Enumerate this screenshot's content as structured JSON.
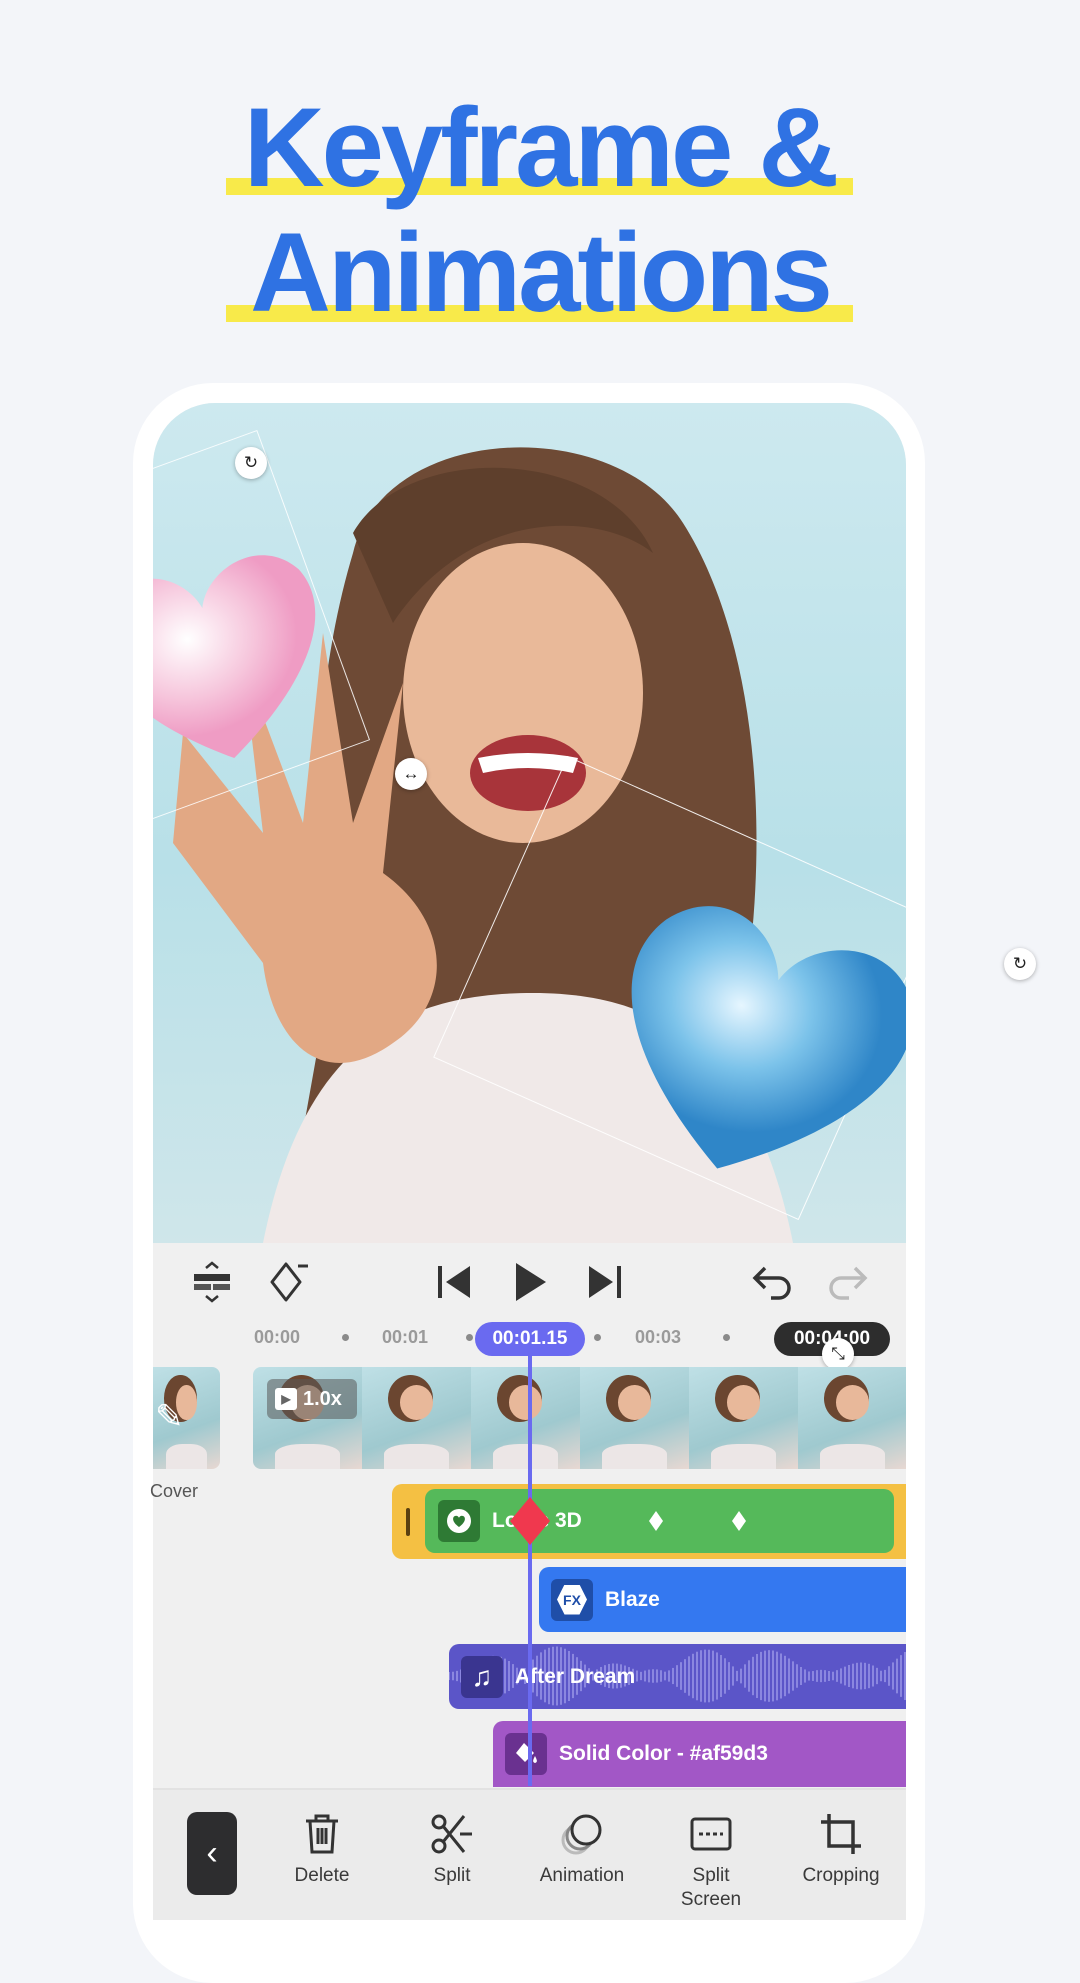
{
  "headline": {
    "line1": "Keyframe &",
    "line2": "Animations"
  },
  "controls": {
    "icons": [
      "track-height-icon",
      "keyframe-icon",
      "skip-back-icon",
      "play-icon",
      "skip-forward-icon",
      "undo-icon",
      "redo-icon"
    ]
  },
  "ruler": {
    "labels": [
      "00:00",
      "00:01",
      "00:03"
    ],
    "current_time": "00:01.15",
    "total_time": "00:04:00"
  },
  "clip": {
    "speed": "1.0x",
    "cover_label": "Cover"
  },
  "tracks": [
    {
      "name": "Lottie 3D",
      "type": "sticker",
      "color": "#55b95a"
    },
    {
      "name": "Blaze",
      "type": "effect",
      "color": "#3478f0"
    },
    {
      "name": "After Dream",
      "type": "audio",
      "color": "#5b55c8"
    },
    {
      "name": "Solid Color - #af59d3",
      "type": "color",
      "color": "#a257c6"
    }
  ],
  "toolbar": {
    "back": "back-icon",
    "items": [
      {
        "label": "Delete",
        "icon": "trash-icon"
      },
      {
        "label": "Split",
        "icon": "scissors-icon"
      },
      {
        "label": "Animation",
        "icon": "animation-icon"
      },
      {
        "label": "Split\nScreen",
        "icon": "split-screen-icon"
      },
      {
        "label": "Cropping",
        "icon": "crop-icon"
      }
    ]
  },
  "colors": {
    "accent": "#2f72e3",
    "highlight": "#f8ea4a",
    "playhead": "#6a6af0"
  }
}
